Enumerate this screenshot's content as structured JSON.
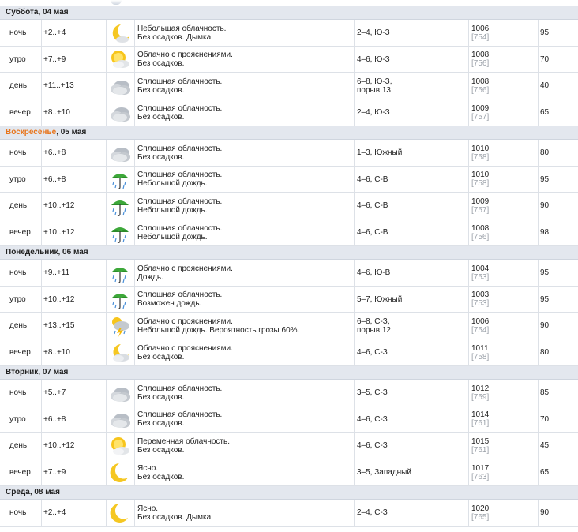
{
  "days": [
    {
      "name": "Суббота",
      "date": ", 04 мая",
      "holiday": false,
      "rows": [
        {
          "period": "ночь",
          "temp": "+2..+4",
          "icon": "moon-partly-cloudy-icon",
          "desc1": "Небольшая облачность.",
          "desc2": "Без осадков. Дымка.",
          "wind1": "2–4, Ю-З",
          "wind2": "",
          "pressure": "1006",
          "pressure_mm": "[754]",
          "humidity": "95"
        },
        {
          "period": "утро",
          "temp": "+7..+9",
          "icon": "sun-cloud-icon",
          "desc1": "Облачно с прояснениями.",
          "desc2": "Без осадков.",
          "wind1": "4–6, Ю-З",
          "wind2": "",
          "pressure": "1008",
          "pressure_mm": "[756]",
          "humidity": "70"
        },
        {
          "period": "день",
          "temp": "+11..+13",
          "icon": "overcast-icon",
          "desc1": "Сплошная облачность.",
          "desc2": "Без осадков.",
          "wind1": "6–8, Ю-З,",
          "wind2": "порыв 13",
          "pressure": "1008",
          "pressure_mm": "[756]",
          "humidity": "40"
        },
        {
          "period": "вечер",
          "temp": "+8..+10",
          "icon": "overcast-icon",
          "desc1": "Сплошная облачность.",
          "desc2": "Без осадков.",
          "wind1": "2–4, Ю-З",
          "wind2": "",
          "pressure": "1009",
          "pressure_mm": "[757]",
          "humidity": "65"
        }
      ]
    },
    {
      "name": "Воскресенье",
      "date": ", 05 мая",
      "holiday": true,
      "rows": [
        {
          "period": "ночь",
          "temp": "+6..+8",
          "icon": "overcast-icon",
          "desc1": "Сплошная облачность.",
          "desc2": "Без осадков.",
          "wind1": "1–3, Южный",
          "wind2": "",
          "pressure": "1010",
          "pressure_mm": "[758]",
          "humidity": "80"
        },
        {
          "period": "утро",
          "temp": "+6..+8",
          "icon": "umbrella-rain-icon",
          "desc1": "Сплошная облачность.",
          "desc2": "Небольшой дождь.",
          "wind1": "4–6, С-В",
          "wind2": "",
          "pressure": "1010",
          "pressure_mm": "[758]",
          "humidity": "95"
        },
        {
          "period": "день",
          "temp": "+10..+12",
          "icon": "umbrella-rain-icon",
          "desc1": "Сплошная облачность.",
          "desc2": "Небольшой дождь.",
          "wind1": "4–6, С-В",
          "wind2": "",
          "pressure": "1009",
          "pressure_mm": "[757]",
          "humidity": "90"
        },
        {
          "period": "вечер",
          "temp": "+10..+12",
          "icon": "umbrella-rain-icon",
          "desc1": "Сплошная облачность.",
          "desc2": "Небольшой дождь.",
          "wind1": "4–6, С-В",
          "wind2": "",
          "pressure": "1008",
          "pressure_mm": "[756]",
          "humidity": "98"
        }
      ]
    },
    {
      "name": "Понедельник",
      "date": ", 06 мая",
      "holiday": false,
      "rows": [
        {
          "period": "ночь",
          "temp": "+9..+11",
          "icon": "umbrella-rain-icon",
          "desc1": "Облачно с прояснениями.",
          "desc2": "Дождь.",
          "wind1": "4–6, Ю-В",
          "wind2": "",
          "pressure": "1004",
          "pressure_mm": "[753]",
          "humidity": "95"
        },
        {
          "period": "утро",
          "temp": "+10..+12",
          "icon": "umbrella-rain-icon",
          "desc1": "Сплошная облачность.",
          "desc2": "Возможен дождь.",
          "wind1": "5–7, Южный",
          "wind2": "",
          "pressure": "1003",
          "pressure_mm": "[753]",
          "humidity": "95"
        },
        {
          "period": "день",
          "temp": "+13..+15",
          "icon": "thunderstorm-icon",
          "desc1": "Облачно с прояснениями.",
          "desc2": "Небольшой дождь. Вероятность грозы 60%.",
          "wind1": "6–8, С-З,",
          "wind2": "порыв 12",
          "pressure": "1006",
          "pressure_mm": "[754]",
          "humidity": "90"
        },
        {
          "period": "вечер",
          "temp": "+8..+10",
          "icon": "moon-cloud-icon",
          "desc1": "Облачно с прояснениями.",
          "desc2": "Без осадков.",
          "wind1": "4–6, С-З",
          "wind2": "",
          "pressure": "1011",
          "pressure_mm": "[758]",
          "humidity": "80"
        }
      ]
    },
    {
      "name": "Вторник",
      "date": ", 07 мая",
      "holiday": false,
      "rows": [
        {
          "period": "ночь",
          "temp": "+5..+7",
          "icon": "overcast-icon",
          "desc1": "Сплошная облачность.",
          "desc2": "Без осадков.",
          "wind1": "3–5, С-З",
          "wind2": "",
          "pressure": "1012",
          "pressure_mm": "[759]",
          "humidity": "85"
        },
        {
          "period": "утро",
          "temp": "+6..+8",
          "icon": "overcast-icon",
          "desc1": "Сплошная облачность.",
          "desc2": "Без осадков.",
          "wind1": "4–6, С-З",
          "wind2": "",
          "pressure": "1014",
          "pressure_mm": "[761]",
          "humidity": "70"
        },
        {
          "period": "день",
          "temp": "+10..+12",
          "icon": "sun-cloud-icon",
          "desc1": "Переменная облачность.",
          "desc2": "Без осадков.",
          "wind1": "4–6, С-З",
          "wind2": "",
          "pressure": "1015",
          "pressure_mm": "[761]",
          "humidity": "45"
        },
        {
          "period": "вечер",
          "temp": "+7..+9",
          "icon": "moon-clear-icon",
          "desc1": "Ясно.",
          "desc2": "Без осадков.",
          "wind1": "3–5, Западный",
          "wind2": "",
          "pressure": "1017",
          "pressure_mm": "[763]",
          "humidity": "65"
        }
      ]
    },
    {
      "name": "Среда",
      "date": ", 08 мая",
      "holiday": false,
      "rows": [
        {
          "period": "ночь",
          "temp": "+2..+4",
          "icon": "moon-clear-icon",
          "desc1": "Ясно.",
          "desc2": "Без осадков. Дымка.",
          "wind1": "2–4, С-З",
          "wind2": "",
          "pressure": "1020",
          "pressure_mm": "[765]",
          "humidity": "90"
        }
      ]
    }
  ],
  "colors": {
    "holiday": "#e8741a",
    "header_bg": "#e3e7ee",
    "grid": "#dde1e7",
    "sub_text": "#9aa0a8"
  }
}
